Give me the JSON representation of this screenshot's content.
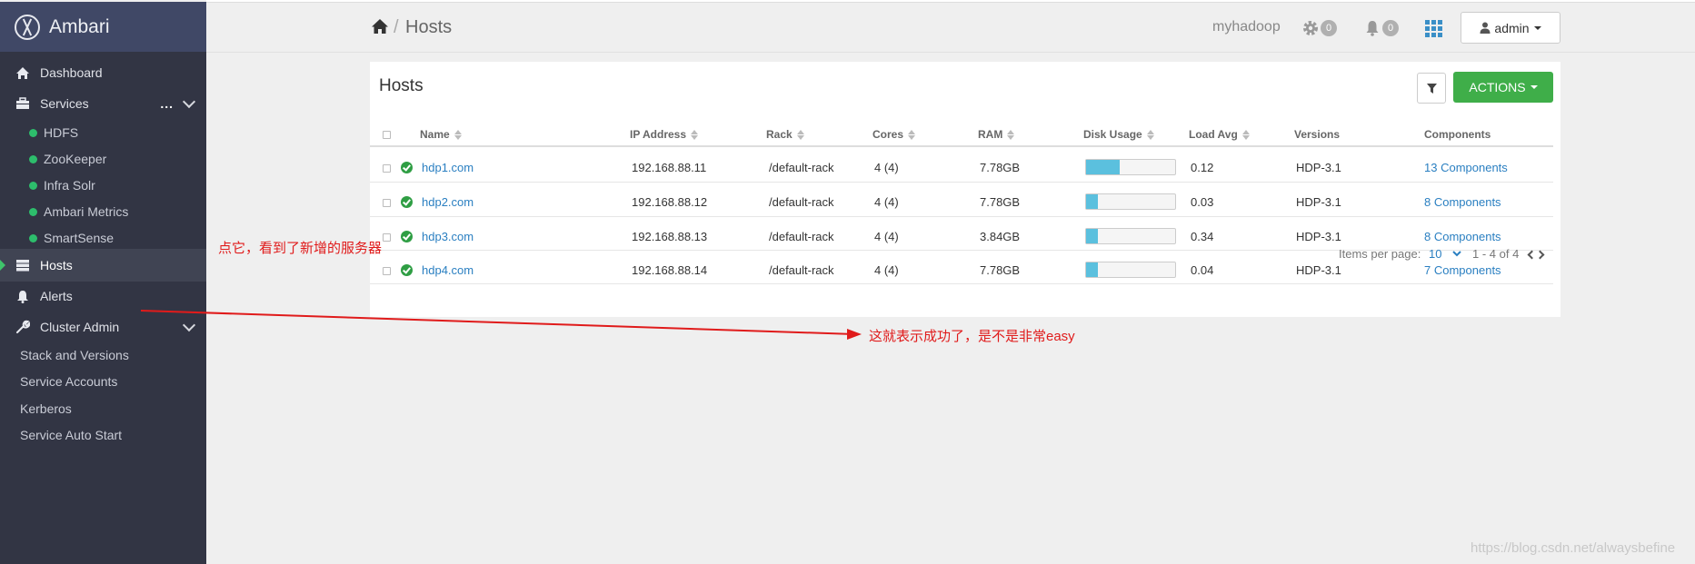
{
  "app": {
    "brand": "Ambari"
  },
  "colors": {
    "sidebar_bg": "#323544",
    "accent_green": "#3fae49",
    "link": "#2a7fc1",
    "annotation": "#e01b1b"
  },
  "sidebar": {
    "dashboard": "Dashboard",
    "services": "Services",
    "services_more": "...",
    "service_items": [
      "HDFS",
      "ZooKeeper",
      "Infra Solr",
      "Ambari Metrics",
      "SmartSense"
    ],
    "hosts": "Hosts",
    "alerts": "Alerts",
    "cluster_admin": "Cluster Admin",
    "cluster_admin_items": [
      "Stack and Versions",
      "Service Accounts",
      "Kerberos",
      "Service Auto Start"
    ]
  },
  "header": {
    "breadcrumb_sep": "/",
    "breadcrumb_title": "Hosts",
    "cluster_name": "myhadoop",
    "settings_count": "0",
    "alerts_count": "0",
    "user": "admin"
  },
  "hosts_card": {
    "title": "Hosts",
    "actions_label": "ACTIONS",
    "columns": [
      "Name",
      "IP Address",
      "Rack",
      "Cores",
      "RAM",
      "Disk Usage",
      "Load Avg",
      "Versions",
      "Components"
    ],
    "rows": [
      {
        "name": "hdp1.com",
        "ip": "192.168.88.11",
        "rack": "/default-rack",
        "cores": "4 (4)",
        "ram": "7.78GB",
        "disk": 0.38,
        "load": "0.12",
        "version": "HDP-3.1",
        "components": "13 Components"
      },
      {
        "name": "hdp2.com",
        "ip": "192.168.88.12",
        "rack": "/default-rack",
        "cores": "4 (4)",
        "ram": "7.78GB",
        "disk": 0.13,
        "load": "0.03",
        "version": "HDP-3.1",
        "components": "8 Components"
      },
      {
        "name": "hdp3.com",
        "ip": "192.168.88.13",
        "rack": "/default-rack",
        "cores": "4 (4)",
        "ram": "3.84GB",
        "disk": 0.13,
        "load": "0.34",
        "version": "HDP-3.1",
        "components": "8 Components"
      },
      {
        "name": "hdp4.com",
        "ip": "192.168.88.14",
        "rack": "/default-rack",
        "cores": "4 (4)",
        "ram": "7.78GB",
        "disk": 0.13,
        "load": "0.04",
        "version": "HDP-3.1",
        "components": "7 Components"
      }
    ],
    "pager": {
      "items_label": "Items per page:",
      "per_page": "10",
      "range": "1 - 4 of 4"
    }
  },
  "annotations": {
    "note1": "点它，看到了新增的服务器",
    "note2": "这就表示成功了，是不是非常easy"
  },
  "watermark": "https://blog.csdn.net/alwaysbefine"
}
